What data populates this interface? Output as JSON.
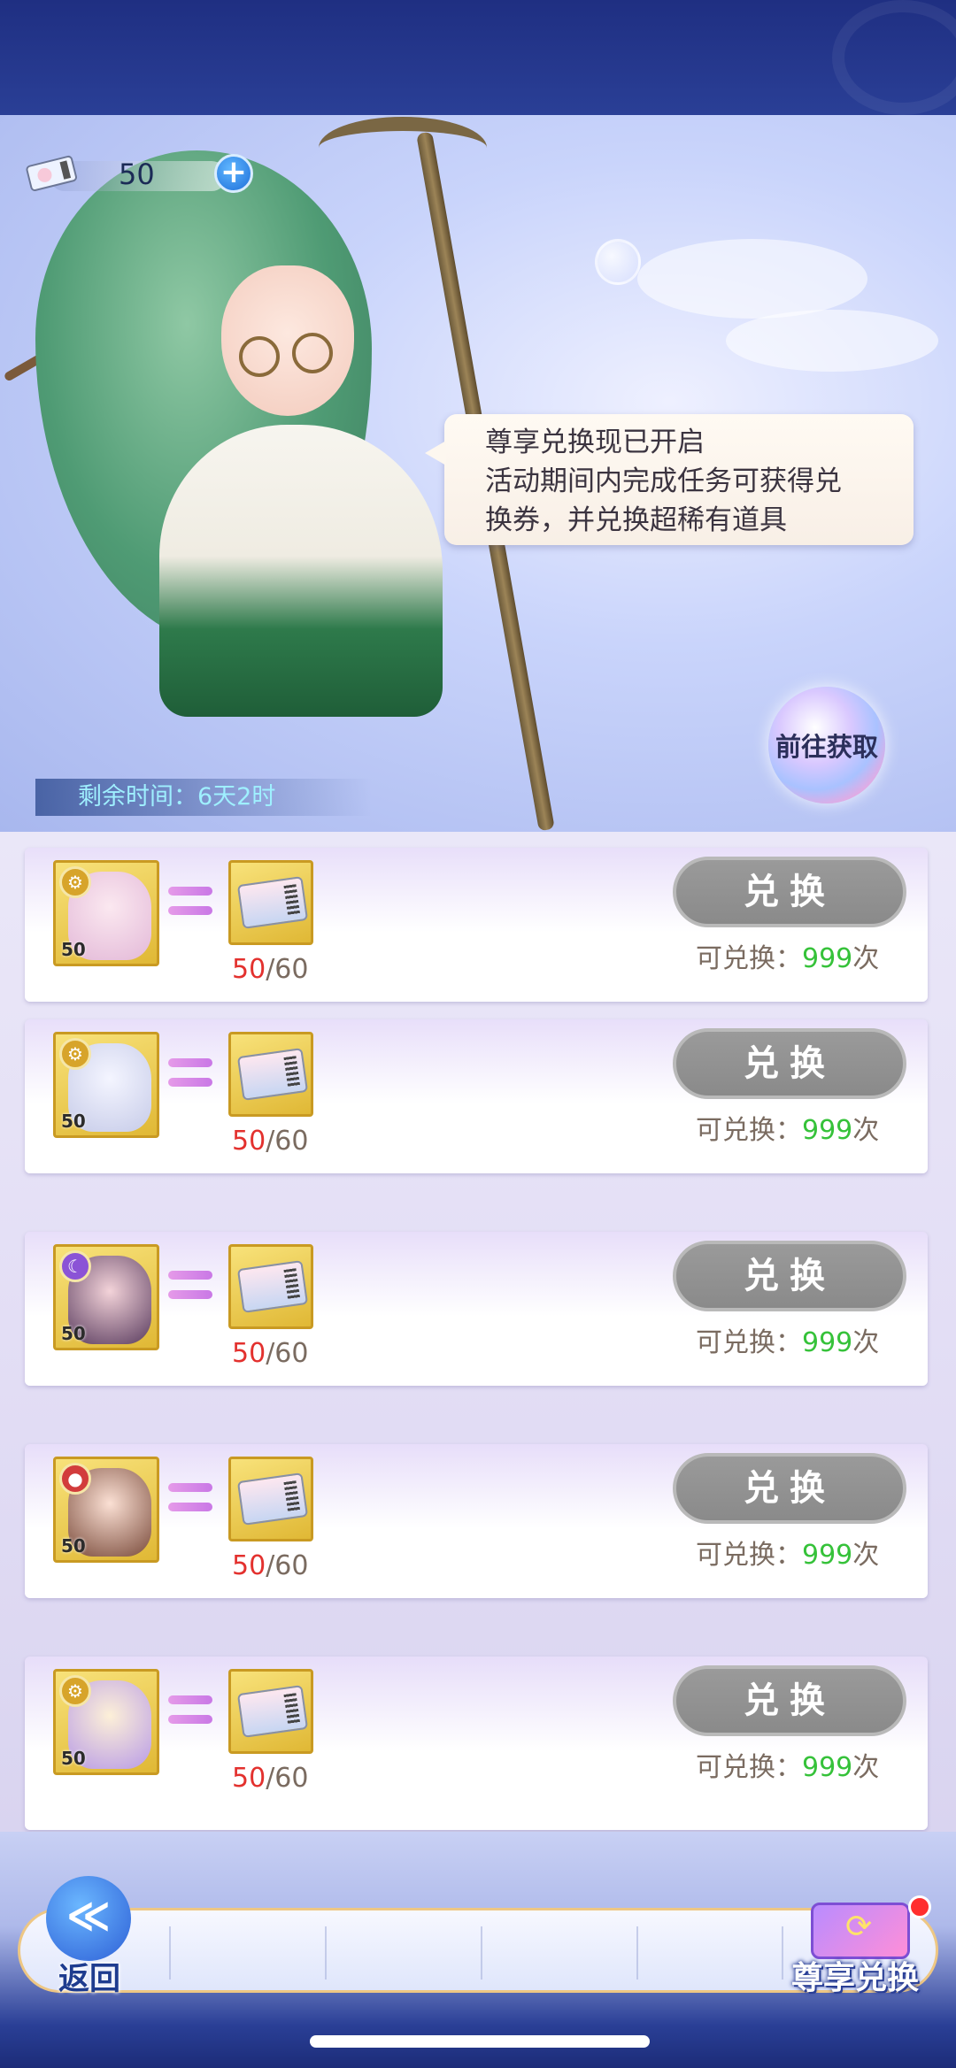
{
  "header": {
    "ticket_count": "50"
  },
  "hero": {
    "speech_lines": [
      "尊享兑换现已开启",
      "活动期间内完成任务可获得兑",
      "换券，并兑换超稀有道具"
    ],
    "goto_button": "前往获取",
    "remaining_time": "剩余时间：6天2时"
  },
  "exchange_rows": [
    {
      "element_icon": "gear-icon",
      "element_color": "#d7a42a",
      "card_qty": "50",
      "progress_current": "50",
      "progress_total": "/60",
      "button": "兑换",
      "avail_label": "可兑换：",
      "avail_num": "999",
      "avail_unit": "次"
    },
    {
      "element_icon": "gear-icon",
      "element_color": "#d7a42a",
      "card_qty": "50",
      "progress_current": "50",
      "progress_total": "/60",
      "button": "兑换",
      "avail_label": "可兑换：",
      "avail_num": "999",
      "avail_unit": "次"
    },
    {
      "element_icon": "moon-icon",
      "element_color": "#8b53d6",
      "card_qty": "50",
      "progress_current": "50",
      "progress_total": "/60",
      "button": "兑换",
      "avail_label": "可兑换：",
      "avail_num": "999",
      "avail_unit": "次"
    },
    {
      "element_icon": "potion-icon",
      "element_color": "#d23c3c",
      "card_qty": "50",
      "progress_current": "50",
      "progress_total": "/60",
      "button": "兑换",
      "avail_label": "可兑换：",
      "avail_num": "999",
      "avail_unit": "次"
    },
    {
      "element_icon": "gear-icon",
      "element_color": "#d7a42a",
      "card_qty": "50",
      "progress_current": "50",
      "progress_total": "/60",
      "button": "兑换",
      "avail_label": "可兑换：",
      "avail_num": "999",
      "avail_unit": "次"
    }
  ],
  "bottom_nav": {
    "back_label": "返回",
    "premium_label": "尊享兑换"
  },
  "colors": {
    "accent_red": "#e3312e",
    "accent_green": "#36c23a",
    "button_gray": "#8a8a8a",
    "card_gold": "#e0b835"
  }
}
